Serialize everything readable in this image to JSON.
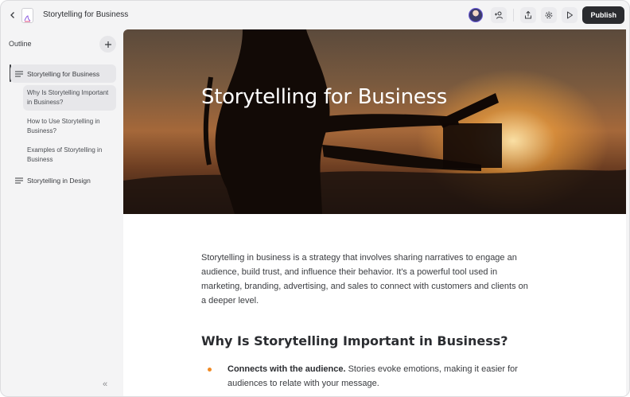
{
  "header": {
    "doc_title": "Storytelling for Business",
    "publish_label": "Publish"
  },
  "sidebar": {
    "outline_label": "Outline",
    "items": [
      {
        "label": "Storytelling for Business",
        "level": 1,
        "active": true
      },
      {
        "label": "Why Is Storytelling Important in Business?",
        "level": 2,
        "active": true
      },
      {
        "label": "How to Use Storytelling in Business?",
        "level": 2,
        "active": false
      },
      {
        "label": "Examples of Storytelling in Business",
        "level": 2,
        "active": false
      },
      {
        "label": "Storytelling in Design",
        "level": 1,
        "active": false
      }
    ],
    "collapse_glyph": "«"
  },
  "main": {
    "hero_title": "Storytelling for Business",
    "intro": "Storytelling in business is a strategy that involves sharing narratives to engage an audience, build trust, and influence their behavior. It's a powerful tool used in marketing, branding, advertising, and sales to connect with customers and clients on a deeper level.",
    "section_heading": "Why Is Storytelling Important in Business?",
    "bullets": [
      {
        "lead": "Connects with the audience.",
        "text": " Stories evoke emotions, making it easier for audiences to relate with your message."
      }
    ]
  },
  "colors": {
    "accent_bullet": "#f08a24",
    "publish_bg": "#2a2b2f"
  }
}
